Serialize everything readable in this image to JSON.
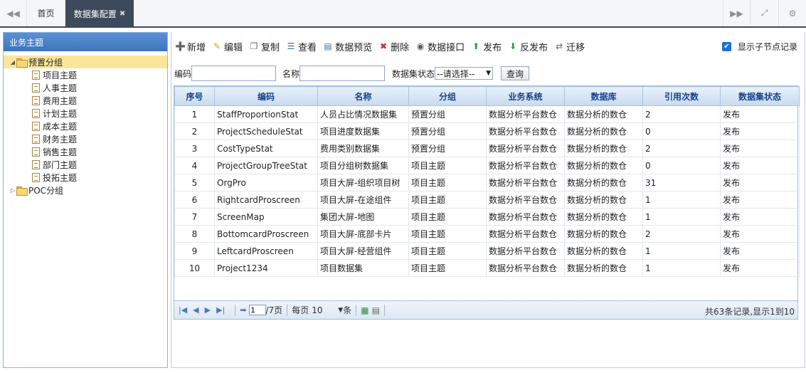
{
  "tabs": {
    "home": "首页",
    "active": "数据集配置",
    "close": "✖"
  },
  "topbar_icons": {
    "prev": "◀◀",
    "next": "▶▶",
    "fullscreen": "⤢",
    "settings": "⚙"
  },
  "sidebar": {
    "title": "业务主题",
    "groups": [
      {
        "label": "预置分组",
        "expanded": true,
        "selected": true,
        "children": [
          "项目主题",
          "人事主题",
          "费用主题",
          "计划主题",
          "成本主题",
          "财务主题",
          "销售主题",
          "部门主题",
          "投拓主题"
        ]
      },
      {
        "label": "POC分组",
        "expanded": false,
        "selected": false,
        "children": []
      }
    ]
  },
  "toolbar": {
    "buttons": [
      {
        "label": "新增",
        "icon": "add-icon",
        "glyph": "➕",
        "color": "#3a7bd5"
      },
      {
        "label": "编辑",
        "icon": "pencil-icon",
        "glyph": "✎",
        "color": "#d99b1f"
      },
      {
        "label": "复制",
        "icon": "copy-icon",
        "glyph": "❐",
        "color": "#4a6a9a"
      },
      {
        "label": "查看",
        "icon": "view-icon",
        "glyph": "☰",
        "color": "#4a6a9a"
      },
      {
        "label": "数据预览",
        "icon": "preview-icon",
        "glyph": "▤",
        "color": "#4a6a9a"
      },
      {
        "label": "删除",
        "icon": "delete-icon",
        "glyph": "✖",
        "color": "#d42a2a"
      },
      {
        "label": "数据接口",
        "icon": "interface-icon",
        "glyph": "◉",
        "color": "#555"
      },
      {
        "label": "发布",
        "icon": "publish-icon",
        "glyph": "⬆",
        "color": "#2e9e3a"
      },
      {
        "label": "反发布",
        "icon": "unpublish-icon",
        "glyph": "⬇",
        "color": "#2e9e3a"
      },
      {
        "label": "迁移",
        "icon": "migrate-icon",
        "glyph": "⇄",
        "color": "#4a6a9a"
      }
    ],
    "show_child_records_label": "显示子节点记录",
    "show_child_records_checked": true
  },
  "search": {
    "code_label": "编码",
    "code_value": "",
    "name_label": "名称",
    "name_value": "",
    "status_label": "数据集状态",
    "status_selected": "--请选择--",
    "query_button": "查询"
  },
  "table": {
    "columns": [
      "序号",
      "编码",
      "名称",
      "分组",
      "业务系统",
      "数据库",
      "引用次数",
      "数据集状态"
    ],
    "rows": [
      [
        "1",
        "StaffProportionStat",
        "人员占比情况数据集",
        "预置分组",
        "数据分析平台数仓",
        "数据分析的数仓",
        "2",
        "发布"
      ],
      [
        "2",
        "ProjectScheduleStat",
        "项目进度数据集",
        "预置分组",
        "数据分析平台数仓",
        "数据分析的数仓",
        "0",
        "发布"
      ],
      [
        "3",
        "CostTypeStat",
        "费用类别数据集",
        "预置分组",
        "数据分析平台数仓",
        "数据分析的数仓",
        "2",
        "发布"
      ],
      [
        "4",
        "ProjectGroupTreeStat",
        "项目分组树数据集",
        "项目主题",
        "数据分析平台数仓",
        "数据分析的数仓",
        "0",
        "发布"
      ],
      [
        "5",
        "OrgPro",
        "项目大屏-组织项目树",
        "项目主题",
        "数据分析平台数仓",
        "数据分析的数仓",
        "31",
        "发布"
      ],
      [
        "6",
        "RightcardProscreen",
        "项目大屏-在途组件",
        "项目主题",
        "数据分析平台数仓",
        "数据分析的数仓",
        "1",
        "发布"
      ],
      [
        "7",
        "ScreenMap",
        "集团大屏-地图",
        "项目主题",
        "数据分析平台数仓",
        "数据分析的数仓",
        "1",
        "发布"
      ],
      [
        "8",
        "BottomcardProscreen",
        "项目大屏-底部卡片",
        "项目主题",
        "数据分析平台数仓",
        "数据分析的数仓",
        "2",
        "发布"
      ],
      [
        "9",
        "LeftcardProscreen",
        "项目大屏-经营组件",
        "项目主题",
        "数据分析平台数仓",
        "数据分析的数仓",
        "1",
        "发布"
      ],
      [
        "10",
        "Project1234",
        "项目数据集",
        "项目主题",
        "数据分析平台数仓",
        "数据分析的数仓",
        "1",
        "发布"
      ]
    ]
  },
  "pager": {
    "current_page": "1",
    "total_pages_label": "/7页",
    "per_page_label": "每页",
    "per_page_value": "10",
    "per_page_unit": "条",
    "info": "共63条记录,显示1到10"
  }
}
